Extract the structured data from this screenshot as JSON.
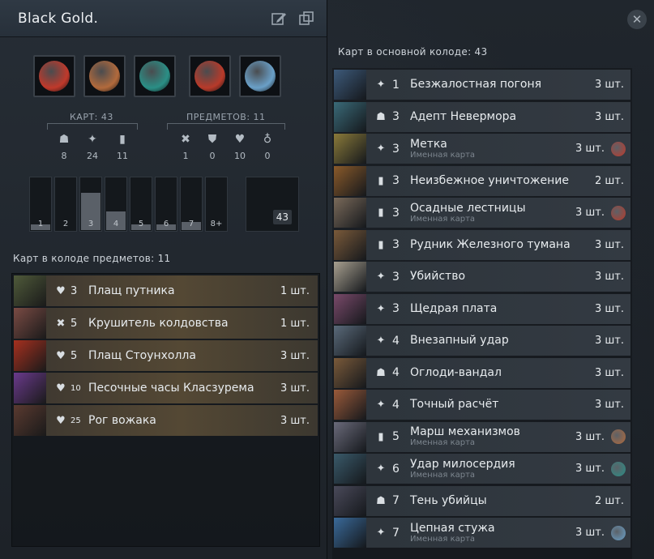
{
  "deck": {
    "title": "Black Gold."
  },
  "toolbar": {
    "edit_icon": "edit-icon",
    "copy_icon": "copy-icon",
    "close_glyph": "✕"
  },
  "heroes": [
    {
      "name": "hero-1",
      "color": "#c0392b"
    },
    {
      "name": "hero-2",
      "color": "#b26a3c"
    },
    {
      "name": "hero-3",
      "color": "#2a8f86"
    },
    {
      "name": "hero-4",
      "color": "#b83a2a"
    },
    {
      "name": "hero-5",
      "color": "#6aa0c8"
    }
  ],
  "stats": {
    "cards_label": "КАРТ: 43",
    "items_label": "ПРЕДМЕТОВ: 11",
    "card_types": [
      {
        "icon": "creep-icon",
        "glyph": "☗",
        "count": "8"
      },
      {
        "icon": "spell-icon",
        "glyph": "✦",
        "count": "24"
      },
      {
        "icon": "improvement-icon",
        "glyph": "▮",
        "count": "11"
      }
    ],
    "item_types": [
      {
        "icon": "weapon-icon",
        "glyph": "✖",
        "count": "1"
      },
      {
        "icon": "armor-icon",
        "glyph": "⛊",
        "count": "0"
      },
      {
        "icon": "health-icon",
        "glyph": "♥",
        "count": "10"
      },
      {
        "icon": "consumable-icon",
        "glyph": "♁",
        "count": "0"
      }
    ]
  },
  "mana_curve": {
    "labels": [
      "1",
      "2",
      "3",
      "4",
      "5",
      "6",
      "7",
      "8+"
    ],
    "levels": [
      0.1,
      0.0,
      0.7,
      0.35,
      0.1,
      0.1,
      0.15,
      0.0
    ],
    "total": "43"
  },
  "items_section": {
    "title": "Карт в колоде предметов: 11",
    "items": [
      {
        "type_icon": "health-icon",
        "glyph": "♥",
        "cost": "3",
        "name": "Плащ путника",
        "qty": "1 шт.",
        "thumb": "#4f5a3a"
      },
      {
        "type_icon": "weapon-icon",
        "glyph": "✖",
        "cost": "5",
        "name": "Крушитель колдовства",
        "qty": "1 шт.",
        "thumb": "#7a4b44"
      },
      {
        "type_icon": "health-icon",
        "glyph": "♥",
        "cost": "5",
        "name": "Плащ Стоунхолла",
        "qty": "3 шт.",
        "thumb": "#a6301f"
      },
      {
        "type_icon": "health-icon",
        "glyph": "♥",
        "cost": "10",
        "name": "Песочные часы Класзурема",
        "qty": "3 шт.",
        "thumb": "#6a3a8c"
      },
      {
        "type_icon": "health-icon",
        "glyph": "♥",
        "cost": "25",
        "name": "Рог вожака",
        "qty": "3 шт.",
        "thumb": "#5a3a30"
      }
    ]
  },
  "main_section": {
    "title": "Карт в основной колоде: 43",
    "cards": [
      {
        "type_icon": "spell-icon",
        "glyph": "✦",
        "cost": "1",
        "name": "Безжалостная погоня",
        "sub": "",
        "qty": "3 шт.",
        "hero": "",
        "thumb": "#3d5a7a"
      },
      {
        "type_icon": "creep-icon",
        "glyph": "☗",
        "cost": "3",
        "name": "Адепт Невермора",
        "sub": "",
        "qty": "3 шт.",
        "hero": "",
        "thumb": "#3a6a78"
      },
      {
        "type_icon": "spell-icon",
        "glyph": "✦",
        "cost": "3",
        "name": "Метка",
        "sub": "Именная карта",
        "qty": "3 шт.",
        "hero": "#c0392b",
        "thumb": "#8a7a3a"
      },
      {
        "type_icon": "improvement-icon",
        "glyph": "▮",
        "cost": "3",
        "name": "Неизбежное уничтожение",
        "sub": "",
        "qty": "2 шт.",
        "hero": "",
        "thumb": "#8a5a2a"
      },
      {
        "type_icon": "improvement-icon",
        "glyph": "▮",
        "cost": "3",
        "name": "Осадные лестницы",
        "sub": "Именная карта",
        "qty": "3 шт.",
        "hero": "#b83a2a",
        "thumb": "#7a6a5a"
      },
      {
        "type_icon": "improvement-icon",
        "glyph": "▮",
        "cost": "3",
        "name": "Рудник Железного тумана",
        "sub": "",
        "qty": "3 шт.",
        "hero": "",
        "thumb": "#7a5a3a"
      },
      {
        "type_icon": "spell-icon",
        "glyph": "✦",
        "cost": "3",
        "name": "Убийство",
        "sub": "",
        "qty": "3 шт.",
        "hero": "",
        "thumb": "#a8a090"
      },
      {
        "type_icon": "spell-icon",
        "glyph": "✦",
        "cost": "3",
        "name": "Щедрая плата",
        "sub": "",
        "qty": "3 шт.",
        "hero": "",
        "thumb": "#7a4a6a"
      },
      {
        "type_icon": "spell-icon",
        "glyph": "✦",
        "cost": "4",
        "name": "Внезапный удар",
        "sub": "",
        "qty": "3 шт.",
        "hero": "",
        "thumb": "#5a6a7a"
      },
      {
        "type_icon": "creep-icon",
        "glyph": "☗",
        "cost": "4",
        "name": "Оглоди-вандал",
        "sub": "",
        "qty": "3 шт.",
        "hero": "",
        "thumb": "#7a5a3a"
      },
      {
        "type_icon": "spell-icon",
        "glyph": "✦",
        "cost": "4",
        "name": "Точный расчёт",
        "sub": "",
        "qty": "3 шт.",
        "hero": "",
        "thumb": "#9a5a3a"
      },
      {
        "type_icon": "improvement-icon",
        "glyph": "▮",
        "cost": "5",
        "name": "Марш механизмов",
        "sub": "Именная карта",
        "qty": "3 шт.",
        "hero": "#b26a3c",
        "thumb": "#6a6a7a"
      },
      {
        "type_icon": "spell-icon",
        "glyph": "✦",
        "cost": "6",
        "name": "Удар милосердия",
        "sub": "Именная карта",
        "qty": "3 шт.",
        "hero": "#2a8f86",
        "thumb": "#3a5a6a"
      },
      {
        "type_icon": "creep-icon",
        "glyph": "☗",
        "cost": "7",
        "name": "Тень убийцы",
        "sub": "",
        "qty": "2 шт.",
        "hero": "",
        "thumb": "#4a4a5a"
      },
      {
        "type_icon": "spell-icon",
        "glyph": "✦",
        "cost": "7",
        "name": "Цепная стужа",
        "sub": "Именная карта",
        "qty": "3 шт.",
        "hero": "#6aa0c8",
        "thumb": "#3a6a9a"
      }
    ]
  }
}
